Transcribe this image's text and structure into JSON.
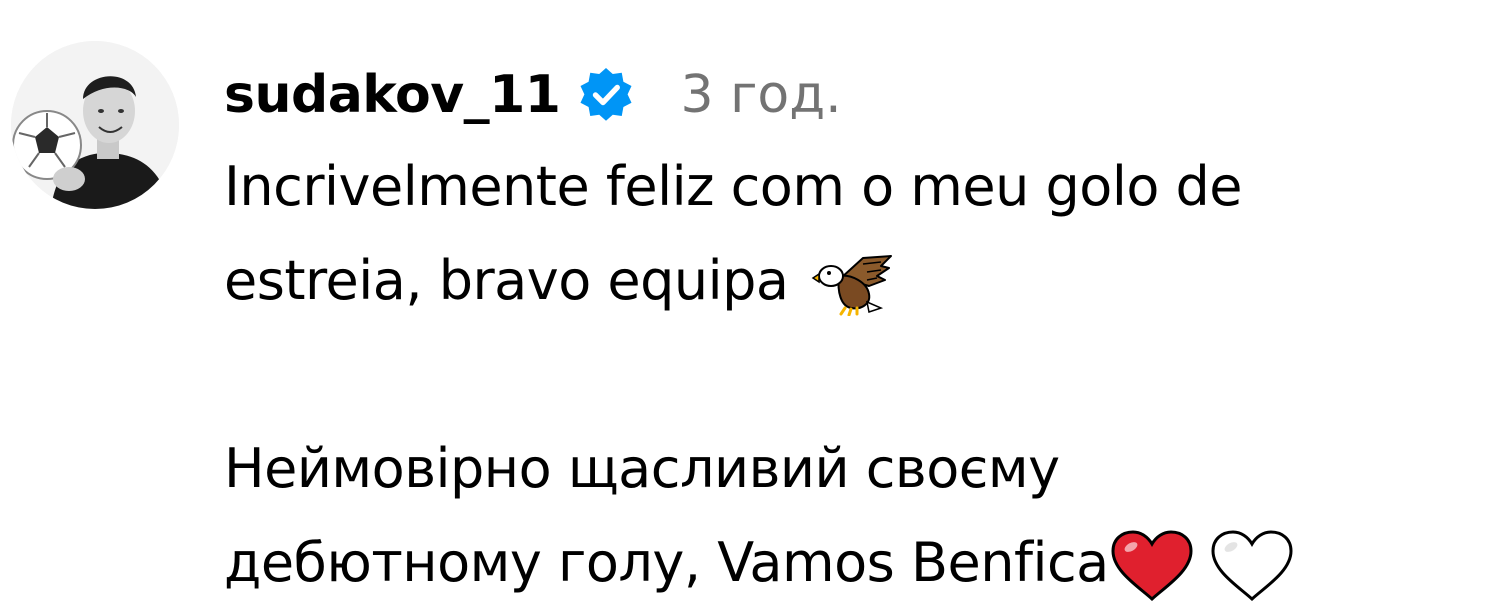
{
  "comment": {
    "username": "sudakov_11",
    "verified": true,
    "timestamp": "3 год.",
    "lines": [
      "Incrivelmente feliz com o meu golo de",
      "estreia, bravo equipa",
      "",
      "Неймовірно щасливий своєму",
      "дебютному голу, Vamos Benfica"
    ],
    "emojis": [
      "eagle-icon",
      "red-heart-icon",
      "white-heart-icon"
    ]
  },
  "colors": {
    "verified_badge": "#0095f6",
    "timestamp": "#737373",
    "heart": "#e0202e"
  }
}
